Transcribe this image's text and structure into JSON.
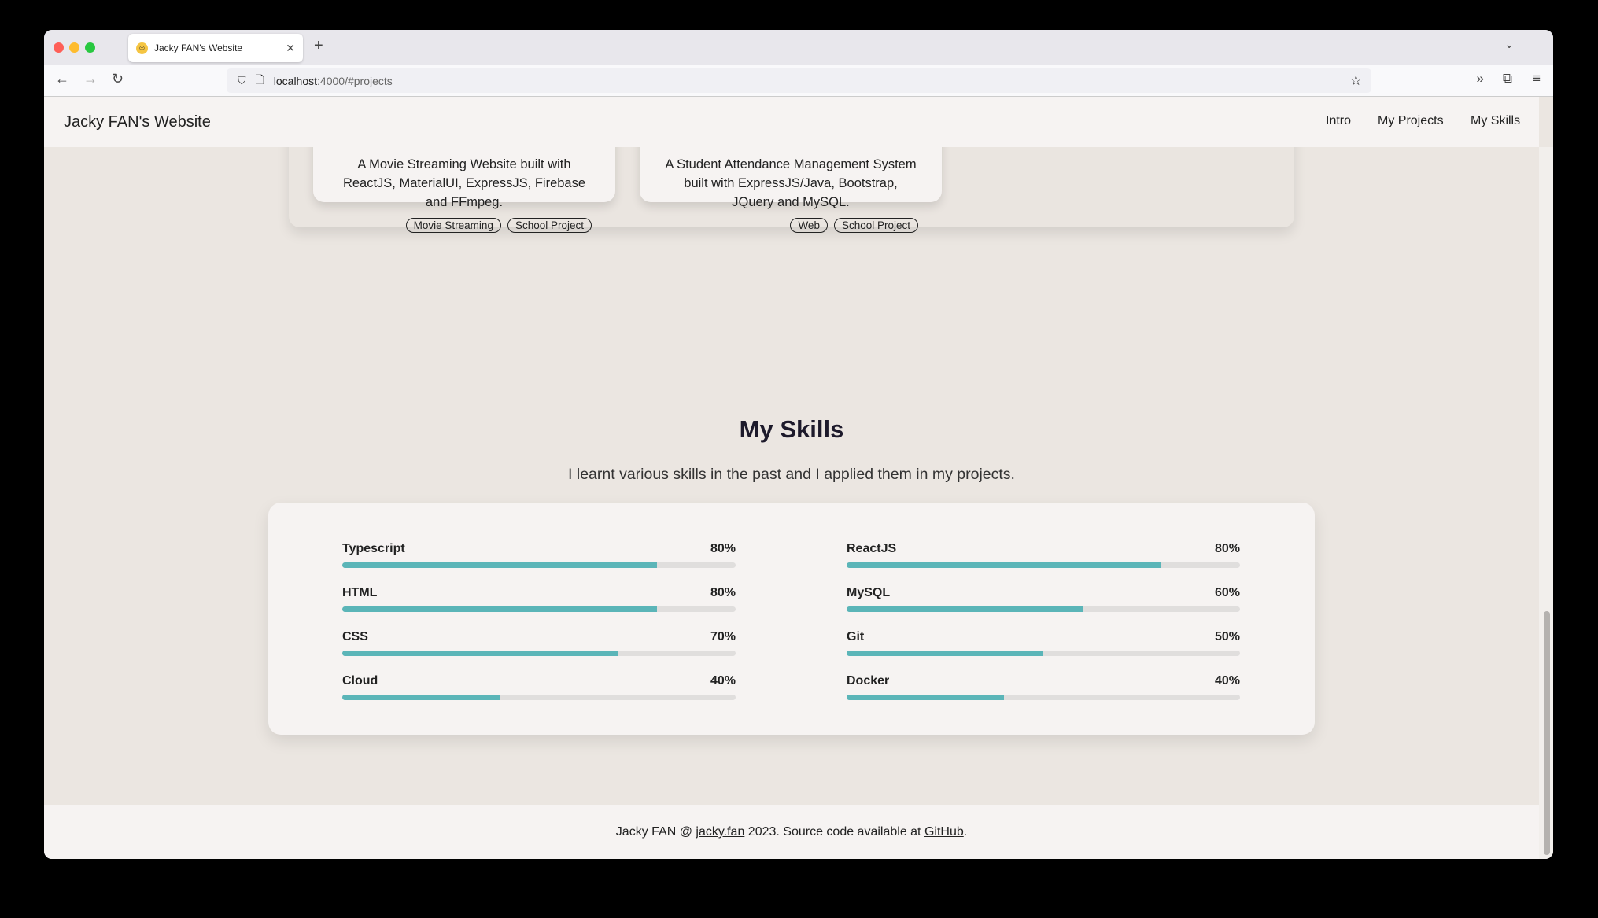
{
  "browser": {
    "tab_title": "Jacky FAN's Website",
    "url_host": "localhost",
    "url_rest": ":4000/#projects"
  },
  "header": {
    "brand": "Jacky FAN's Website",
    "nav": [
      "Intro",
      "My Projects",
      "My Skills"
    ]
  },
  "projects": [
    {
      "description": "A Movie Streaming Website built with ReactJS, MaterialUI, ExpressJS, Firebase and FFmpeg.",
      "tags": [
        "Movie Streaming",
        "School Project"
      ]
    },
    {
      "description": "A Student Attendance Management System built with ExpressJS/Java, Bootstrap, JQuery and MySQL.",
      "tags": [
        "Web",
        "School Project"
      ]
    }
  ],
  "skills_section": {
    "title": "My Skills",
    "subtitle": "I learnt various skills in the past and I applied them in my projects."
  },
  "skills": [
    {
      "name": "Typescript",
      "percent": 80,
      "label": "80%"
    },
    {
      "name": "ReactJS",
      "percent": 80,
      "label": "80%"
    },
    {
      "name": "HTML",
      "percent": 80,
      "label": "80%"
    },
    {
      "name": "MySQL",
      "percent": 60,
      "label": "60%"
    },
    {
      "name": "CSS",
      "percent": 70,
      "label": "70%"
    },
    {
      "name": "Git",
      "percent": 50,
      "label": "50%"
    },
    {
      "name": "Cloud",
      "percent": 40,
      "label": "40%"
    },
    {
      "name": "Docker",
      "percent": 40,
      "label": "40%"
    }
  ],
  "footer": {
    "prefix": "Jacky FAN @ ",
    "link1": "jacky.fan",
    "middle": " 2023. Source code available at ",
    "link2": "GitHub",
    "suffix": "."
  },
  "colors": {
    "accent": "#5bb5b8",
    "track": "#e0dedd"
  }
}
